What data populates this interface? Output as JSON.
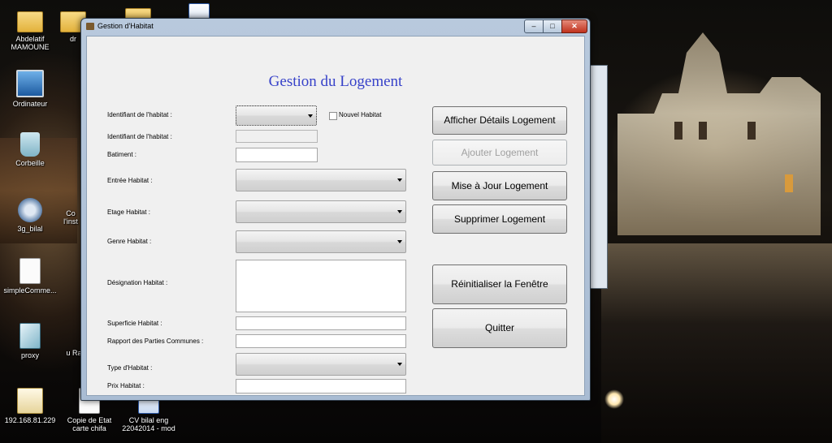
{
  "desktop": {
    "icons": [
      {
        "label": "Abdelatif MAMOUNE",
        "icon": "user-folder-icon"
      },
      {
        "label": "dr",
        "icon": "folder-icon"
      },
      {
        "label": "Ordinateur",
        "icon": "computer-icon"
      },
      {
        "label": "Corbeille",
        "icon": "recycle-bin-icon"
      },
      {
        "label": "3g_bilal",
        "icon": "gear-shortcut-icon"
      },
      {
        "label": "Co l'inst",
        "icon": "installer-icon"
      },
      {
        "label": "simpleComme...",
        "icon": "document-icon"
      },
      {
        "label": "proxy",
        "icon": "script-icon"
      },
      {
        "label": "u Ra",
        "icon": "app-icon"
      },
      {
        "label": "192.168.81.229",
        "icon": "certificate-icon"
      },
      {
        "label": "Copie de Etat carte chifa",
        "icon": "document-icon"
      },
      {
        "label": "CV bilal eng 22042014 - mod",
        "icon": "word-document-icon"
      }
    ]
  },
  "window": {
    "title": "Gestion d'Habitat",
    "controls": {
      "minimize": "–",
      "maximize": "□",
      "close": "✕"
    },
    "heading": "Gestion du Logement",
    "form": {
      "id_label": "Identifiant de l'habitat :",
      "new_habitat_label": "Nouvel Habitat",
      "id_label2": "Identifiant de l'habitat :",
      "batiment_label": "Batiment :",
      "entree_label": "Entrée Habitat :",
      "etage_label": "Etage Habitat :",
      "genre_label": "Genre Habitat :",
      "designation_label": "Désignation Habitat :",
      "superficie_label": "Superficie Habitat :",
      "rapport_label": "Rapport des Parties Communes :",
      "type_label": "Type d'Habitat :",
      "prix_label": "Prix Habitat :"
    },
    "buttons": {
      "afficher": "Afficher Détails Logement",
      "ajouter": "Ajouter Logement",
      "mise_a_jour": "Mise à Jour Logement",
      "supprimer": "Supprimer Logement",
      "reinitialiser": "Réinitialiser la Fenêtre",
      "quitter": "Quitter"
    }
  }
}
